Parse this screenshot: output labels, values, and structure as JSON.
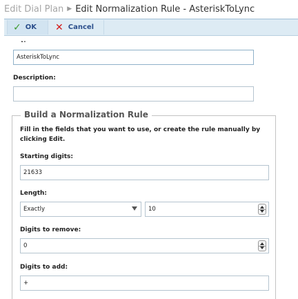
{
  "breadcrumb": {
    "parent": "Edit Dial Plan",
    "current": "Edit Normalization Rule - AsteriskToLync"
  },
  "toolbar": {
    "ok_label": "OK",
    "cancel_label": "Cancel"
  },
  "form": {
    "name_value": "AsteriskToLync",
    "description_label": "Description:",
    "description_value": ""
  },
  "rule_builder": {
    "legend": "Build a Normalization Rule",
    "hint": "Fill in the fields that you want to use, or create the rule manually by clicking Edit.",
    "starting_digits_label": "Starting digits:",
    "starting_digits_value": "21633",
    "length_label": "Length:",
    "length_mode_selected": "Exactly",
    "length_value": "10",
    "digits_to_remove_label": "Digits to remove:",
    "digits_to_remove_value": "0",
    "digits_to_add_label": "Digits to add:",
    "digits_to_add_value": "+"
  },
  "icons": {
    "ok": "check-icon",
    "cancel": "x-icon",
    "separator": "triangle-right-icon",
    "dropdown": "chevron-down-icon",
    "spinner": "spinner-icon"
  },
  "colors": {
    "toolbar_bg": "#ddebf4",
    "toolbar_text": "#2c4f8c",
    "ok_icon": "#3e9b2f",
    "cancel_icon": "#d41a1a"
  }
}
